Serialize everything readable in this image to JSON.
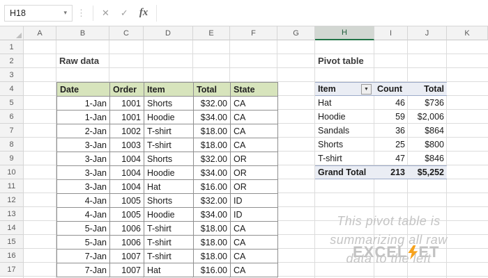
{
  "formula_bar": {
    "name_box": "H18",
    "dropdown_icon": "▾",
    "drag_dots": "⋮",
    "cancel_icon": "✕",
    "enter_icon": "✓",
    "fx_label": "fx"
  },
  "columns": [
    "A",
    "B",
    "C",
    "D",
    "E",
    "F",
    "G",
    "H",
    "I",
    "J",
    "K"
  ],
  "selected_column": "H",
  "rows": [
    "1",
    "2",
    "3",
    "4",
    "5",
    "6",
    "7",
    "8",
    "9",
    "10",
    "11",
    "12",
    "13",
    "14",
    "15",
    "16",
    "17"
  ],
  "labels": {
    "raw_data": "Raw data",
    "pivot_table": "Pivot table"
  },
  "raw_table": {
    "headers": [
      "Date",
      "Order",
      "Item",
      "Total",
      "State"
    ],
    "rows": [
      [
        "1-Jan",
        "1001",
        "Shorts",
        "$32.00",
        "CA"
      ],
      [
        "1-Jan",
        "1001",
        "Hoodie",
        "$34.00",
        "CA"
      ],
      [
        "2-Jan",
        "1002",
        "T-shirt",
        "$18.00",
        "CA"
      ],
      [
        "3-Jan",
        "1003",
        "T-shirt",
        "$18.00",
        "CA"
      ],
      [
        "3-Jan",
        "1004",
        "Shorts",
        "$32.00",
        "OR"
      ],
      [
        "3-Jan",
        "1004",
        "Hoodie",
        "$34.00",
        "OR"
      ],
      [
        "3-Jan",
        "1004",
        "Hat",
        "$16.00",
        "OR"
      ],
      [
        "4-Jan",
        "1005",
        "Shorts",
        "$32.00",
        "ID"
      ],
      [
        "4-Jan",
        "1005",
        "Hoodie",
        "$34.00",
        "ID"
      ],
      [
        "5-Jan",
        "1006",
        "T-shirt",
        "$18.00",
        "CA"
      ],
      [
        "5-Jan",
        "1006",
        "T-shirt",
        "$18.00",
        "CA"
      ],
      [
        "7-Jan",
        "1007",
        "T-shirt",
        "$18.00",
        "CA"
      ],
      [
        "7-Jan",
        "1007",
        "Hat",
        "$16.00",
        "CA"
      ]
    ]
  },
  "pivot": {
    "headers": [
      "Item",
      "Count",
      "Total"
    ],
    "filter_icon": "▼",
    "rows": [
      [
        "Hat",
        "46",
        "$736"
      ],
      [
        "Hoodie",
        "59",
        "$2,006"
      ],
      [
        "Sandals",
        "36",
        "$864"
      ],
      [
        "Shorts",
        "25",
        "$800"
      ],
      [
        "T-shirt",
        "47",
        "$846"
      ]
    ],
    "grand_total": [
      "Grand Total",
      "213",
      "$5,252"
    ]
  },
  "watermark": {
    "lines": [
      "This pivot table is",
      "summarizing all raw",
      "data to the left"
    ],
    "logo_left": "EXCEL",
    "logo_right": "ET",
    "logo_bolt_icon": "lightning-bolt-icon"
  },
  "colors": {
    "accent_green": "#217346",
    "table_header_green": "#D7E4BC",
    "pivot_band_blue": "#EAEDF4",
    "watermark_gray": "#C4C4C4",
    "logo_orange": "#F6A21C"
  }
}
